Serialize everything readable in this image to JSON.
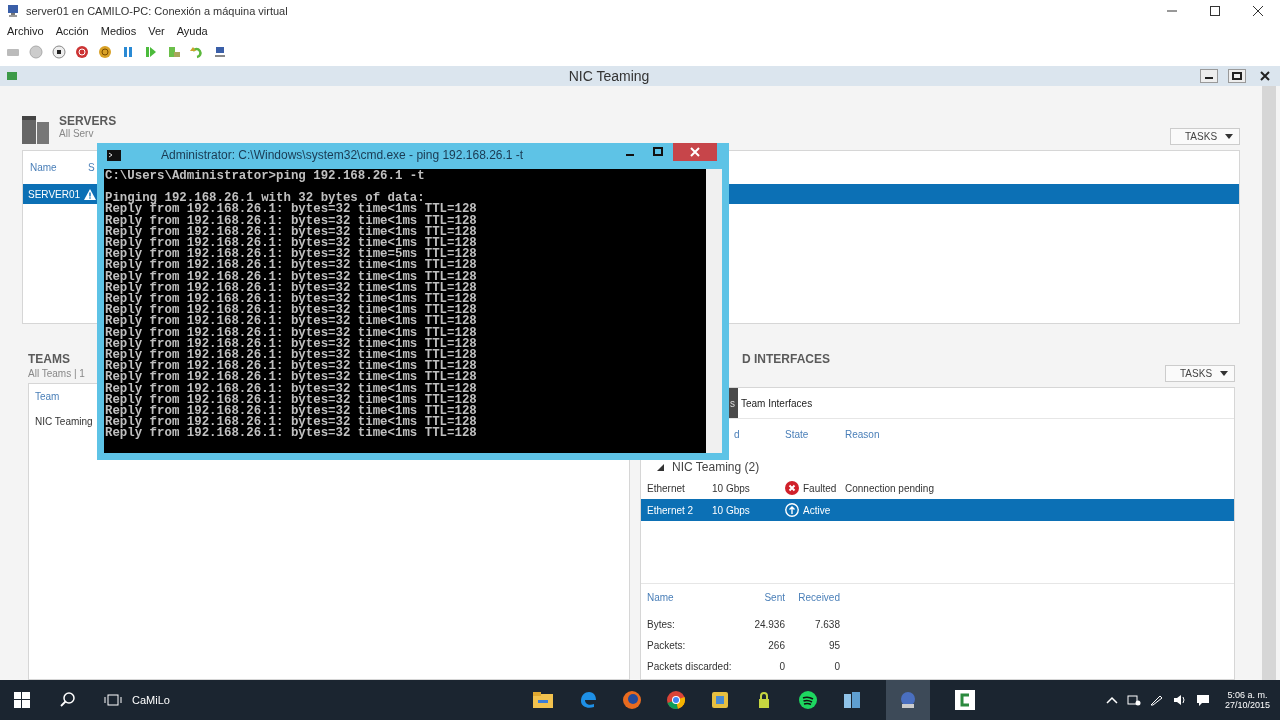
{
  "vm_window": {
    "title": "server01 en CAMILO-PC: Conexión a máquina virtual",
    "menu": [
      "Archivo",
      "Acción",
      "Medios",
      "Ver",
      "Ayuda"
    ]
  },
  "nic_window": {
    "title": "NIC Teaming"
  },
  "servers": {
    "title": "SERVERS",
    "subtitle": "All Serv",
    "tasks": "TASKS",
    "columns": [
      "Name",
      "S"
    ],
    "rows": [
      {
        "name": "SERVER01",
        "warning": true,
        "selected": true
      }
    ]
  },
  "teams": {
    "title": "TEAMS",
    "subtitle": "All Teams | 1",
    "columns": [
      "Team"
    ],
    "rows": [
      {
        "name": "NIC Teaming",
        "selected": false
      }
    ]
  },
  "adapters": {
    "title": "D INTERFACES",
    "tasks": "TASKS",
    "tabs": [
      {
        "label": "s",
        "selected": true
      },
      {
        "label": "Team Interfaces",
        "selected": false
      }
    ],
    "columns": [
      "d",
      "State",
      "Reason"
    ],
    "group": {
      "label": "NIC Teaming (2)",
      "expanded": true
    },
    "rows": [
      {
        "name": "Ethernet",
        "speed": "10 Gbps",
        "kind": "faulted",
        "state": "Faulted",
        "reason": "Connection pending",
        "selected": false
      },
      {
        "name": "Ethernet 2",
        "speed": "10 Gbps",
        "kind": "active",
        "state": "Active",
        "selected": true
      }
    ],
    "stats": {
      "columns": [
        "Name",
        "Sent",
        "Received"
      ],
      "rows": [
        [
          "Bytes:",
          "24.936",
          "7.638"
        ],
        [
          "Packets:",
          "266",
          "95"
        ],
        [
          "Packets discarded:",
          "0",
          "0"
        ]
      ]
    }
  },
  "cmd": {
    "title": "Administrator: C:\\Windows\\system32\\cmd.exe - ping  192.168.26.1 -t",
    "prompt": "C:\\Users\\Administrator>ping 192.168.26.1 -t",
    "output": [
      "Pinging 192.168.26.1 with 32 bytes of data:",
      "Reply from 192.168.26.1: bytes=32 time<1ms TTL=128",
      "Reply from 192.168.26.1: bytes=32 time<1ms TTL=128",
      "Reply from 192.168.26.1: bytes=32 time<1ms TTL=128",
      "Reply from 192.168.26.1: bytes=32 time<1ms TTL=128",
      "Reply from 192.168.26.1: bytes=32 time=5ms TTL=128",
      "Reply from 192.168.26.1: bytes=32 time<1ms TTL=128",
      "Reply from 192.168.26.1: bytes=32 time<1ms TTL=128",
      "Reply from 192.168.26.1: bytes=32 time<1ms TTL=128",
      "Reply from 192.168.26.1: bytes=32 time<1ms TTL=128",
      "Reply from 192.168.26.1: bytes=32 time<1ms TTL=128",
      "Reply from 192.168.26.1: bytes=32 time<1ms TTL=128",
      "Reply from 192.168.26.1: bytes=32 time<1ms TTL=128",
      "Reply from 192.168.26.1: bytes=32 time<1ms TTL=128",
      "Reply from 192.168.26.1: bytes=32 time<1ms TTL=128",
      "Reply from 192.168.26.1: bytes=32 time<1ms TTL=128",
      "Reply from 192.168.26.1: bytes=32 time<1ms TTL=128",
      "Reply from 192.168.26.1: bytes=32 time<1ms TTL=128",
      "Reply from 192.168.26.1: bytes=32 time<1ms TTL=128",
      "Reply from 192.168.26.1: bytes=32 time<1ms TTL=128",
      "Reply from 192.168.26.1: bytes=32 time<1ms TTL=128",
      "Reply from 192.168.26.1: bytes=32 time<1ms TTL=128"
    ]
  },
  "taskbar": {
    "user": "CaMiLo",
    "time": "5:06 a. m.",
    "date": "27/10/2015"
  }
}
